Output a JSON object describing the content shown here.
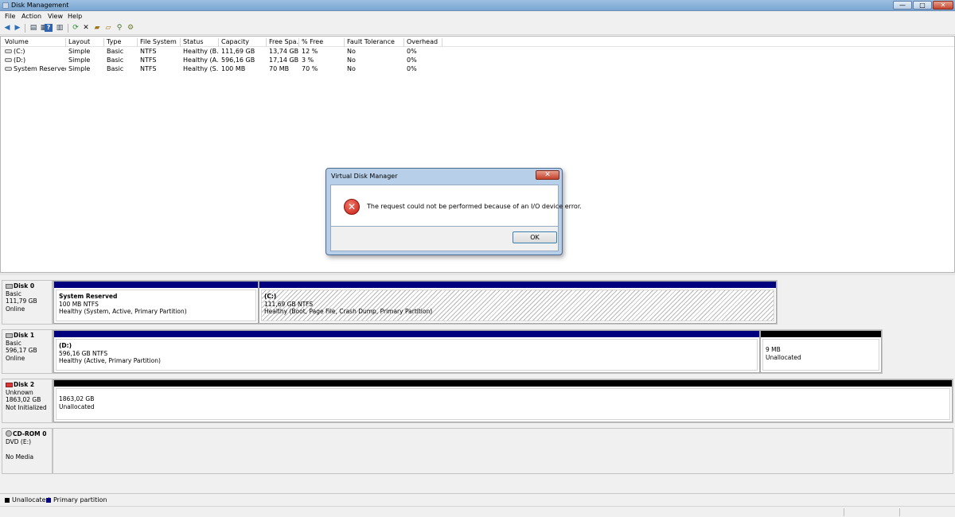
{
  "window": {
    "title": "Disk Management",
    "controls": {
      "minimize": "—",
      "maximize": "□",
      "close": "✕"
    }
  },
  "menu": [
    "File",
    "Action",
    "View",
    "Help"
  ],
  "toolbar": [
    "back-icon",
    "forward-icon",
    "console-tree-icon",
    "properties-icon",
    "help-icon",
    "show-pane-icon",
    "refresh-icon",
    "delete-icon",
    "open-icon",
    "explore-icon",
    "search-icon",
    "settings-icon"
  ],
  "volume_table": {
    "columns": [
      "Volume",
      "Layout",
      "Type",
      "File System",
      "Status",
      "Capacity",
      "Free Spa...",
      "% Free",
      "Fault Tolerance",
      "Overhead"
    ],
    "rows": [
      [
        "(C:)",
        "Simple",
        "Basic",
        "NTFS",
        "Healthy (B...",
        "111,69 GB",
        "13,74 GB",
        "12 %",
        "No",
        "0%"
      ],
      [
        "(D:)",
        "Simple",
        "Basic",
        "NTFS",
        "Healthy (A...",
        "596,16 GB",
        "17,14 GB",
        "3 %",
        "No",
        "0%"
      ],
      [
        "System Reserved",
        "Simple",
        "Basic",
        "NTFS",
        "Healthy (S...",
        "100 MB",
        "70 MB",
        "70 %",
        "No",
        "0%"
      ]
    ]
  },
  "disks": [
    {
      "name": "Disk 0",
      "type": "Basic",
      "size": "111,79 GB",
      "status": "Online",
      "partitions": [
        {
          "name": "System Reserved",
          "detail": "100 MB NTFS",
          "health": "Healthy (System, Active, Primary Partition)",
          "kind": "primary"
        },
        {
          "name": "(C:)",
          "detail": "111,69 GB NTFS",
          "health": "Healthy (Boot, Page File, Crash Dump, Primary Partition)",
          "kind": "primary"
        }
      ]
    },
    {
      "name": "Disk 1",
      "type": "Basic",
      "size": "596,17 GB",
      "status": "Online",
      "partitions": [
        {
          "name": "(D:)",
          "detail": "596,16 GB NTFS",
          "health": "Healthy (Active, Primary Partition)",
          "kind": "primary"
        },
        {
          "detail": "9 MB",
          "health": "Unallocated",
          "kind": "unallocated"
        }
      ]
    },
    {
      "name": "Disk 2",
      "type": "Unknown",
      "size": "1863,02 GB",
      "status": "Not Initialized",
      "partitions": [
        {
          "detail": "1863,02 GB",
          "health": "Unallocated",
          "kind": "unallocated"
        }
      ]
    },
    {
      "name": "CD-ROM 0",
      "type": "DVD (E:)",
      "size": "",
      "status": "No Media",
      "partitions": []
    }
  ],
  "legend": {
    "unallocated": "Unallocated",
    "primary": "Primary partition",
    "colors": {
      "unallocated": "#000000",
      "primary": "#00007e"
    }
  },
  "dialog": {
    "title": "Virtual Disk Manager",
    "message": "The request could not be performed because of an I/O device error.",
    "ok_label": "OK",
    "icon": "error-icon"
  }
}
